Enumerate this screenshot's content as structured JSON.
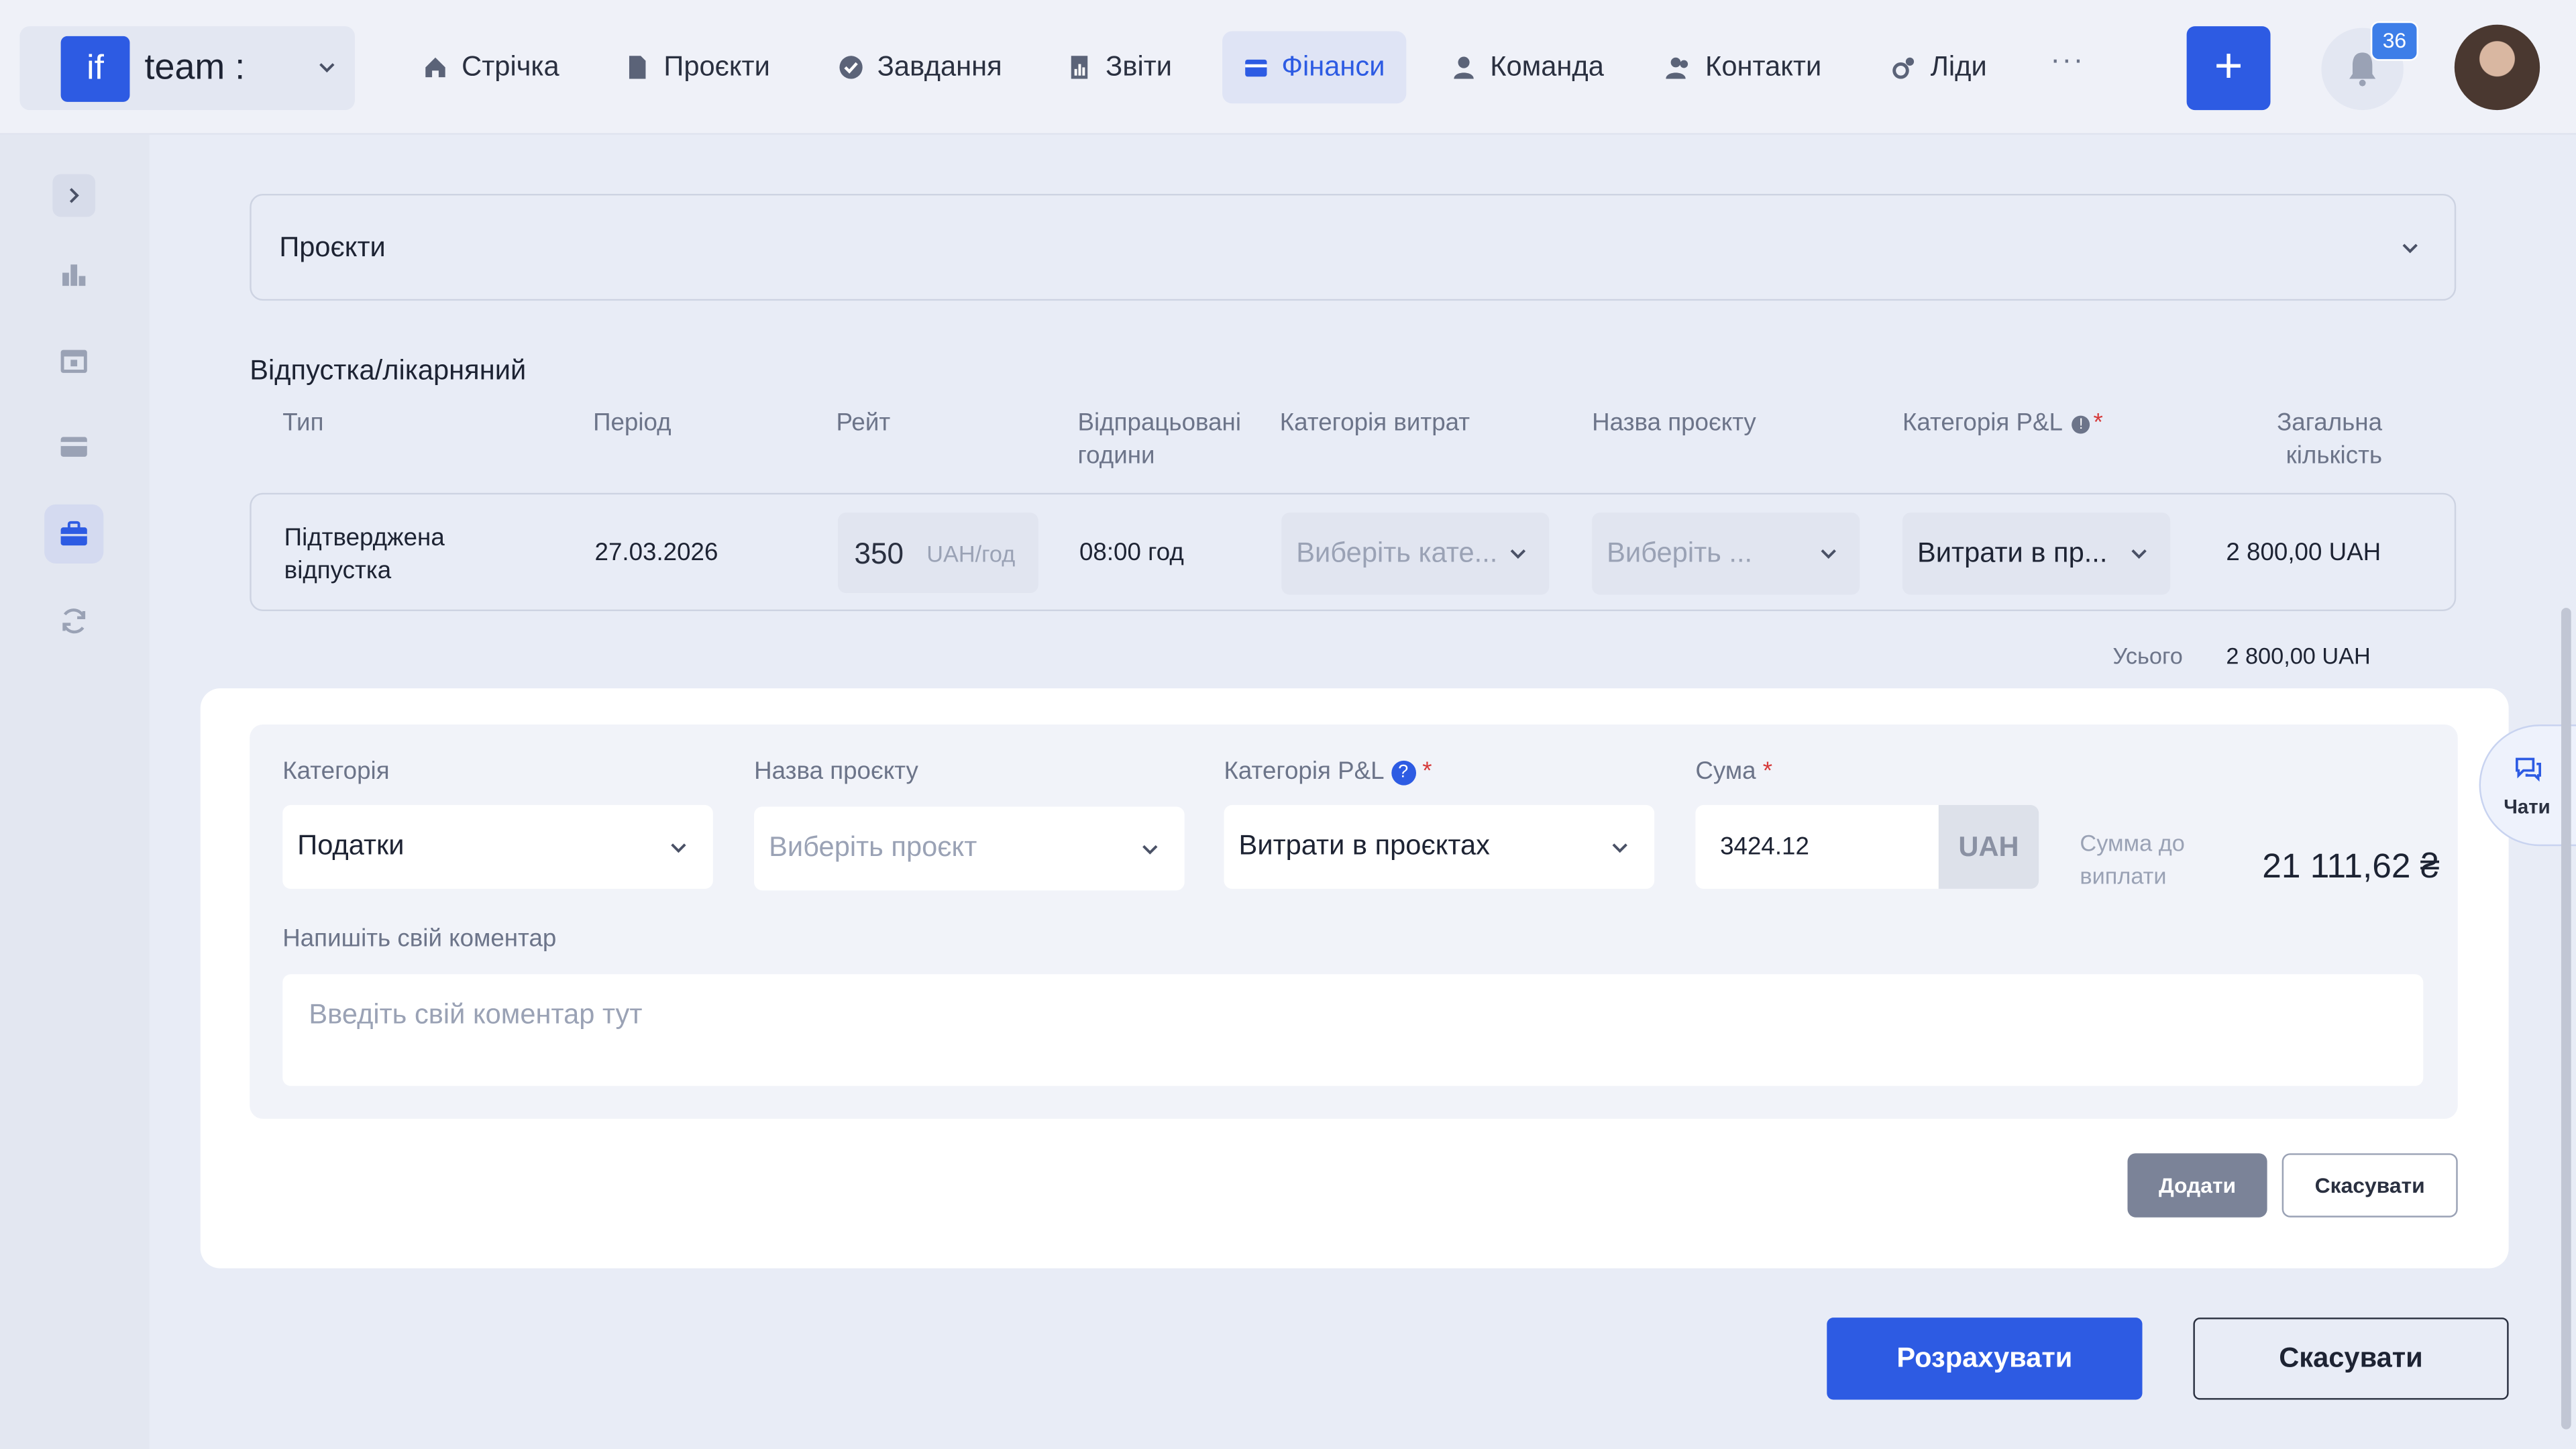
{
  "header": {
    "workspace_logo": "if",
    "workspace_name": "team :",
    "nav": [
      {
        "label": "Стрічка",
        "icon": "home-icon"
      },
      {
        "label": "Проєкти",
        "icon": "document-icon"
      },
      {
        "label": "Завдання",
        "icon": "check-circle-icon"
      },
      {
        "label": "Звіти",
        "icon": "report-icon"
      },
      {
        "label": "Фінанси",
        "icon": "wallet-icon"
      },
      {
        "label": "Команда",
        "icon": "person-icon"
      },
      {
        "label": "Контакти",
        "icon": "contacts-icon"
      },
      {
        "label": "Ліди",
        "icon": "leads-icon"
      }
    ],
    "active_nav": "Фінанси",
    "more": "···",
    "add_label": "+",
    "notifications_count": "36"
  },
  "projects_accordion": {
    "label": "Проєкти"
  },
  "vacation": {
    "title": "Відпустка/лікарняний",
    "columns": {
      "type": "Тип",
      "period": "Період",
      "rate": "Рейт",
      "hours": "Відпрацьовані години",
      "expense_category": "Категорія витрат",
      "project_name": "Назва проєкту",
      "pl_category": "Категорія P&L",
      "total": "Загальна кількість"
    },
    "row": {
      "type": "Підтверджена відпустка",
      "period": "27.03.2026",
      "rate_value": "350",
      "rate_unit": "UAH/год",
      "hours": "08:00 год",
      "expense_category_placeholder": "Виберіть кате...",
      "project_placeholder": "Виберіть ...",
      "pl_category": "Витрати в пр...",
      "total": "2 800,00 UAH"
    },
    "sum_label": "Усього",
    "sum_value": "2 800,00 UAH"
  },
  "expense_form": {
    "category_label": "Категорія",
    "category_value": "Податки",
    "project_label": "Назва проєкту",
    "project_placeholder": "Виберіть проєкт",
    "pl_label": "Категорія P&L",
    "pl_value": "Витрати в проєктах",
    "amount_label": "Сума",
    "amount_value": "3424.12",
    "amount_currency": "UAH",
    "payout_label": "Сумма до виплати",
    "payout_value": "21 111,62 ₴",
    "comment_label": "Напишіть свій коментар",
    "comment_placeholder": "Введіть свій коментар тут",
    "add_button": "Додати",
    "cancel_button": "Скасувати"
  },
  "footer": {
    "calculate_button": "Розрахувати",
    "cancel_button": "Скасувати"
  },
  "chats": {
    "label": "Чати"
  },
  "colors": {
    "accent": "#2d5be3",
    "background": "#e8ecf6",
    "required": "#d63b3b"
  }
}
